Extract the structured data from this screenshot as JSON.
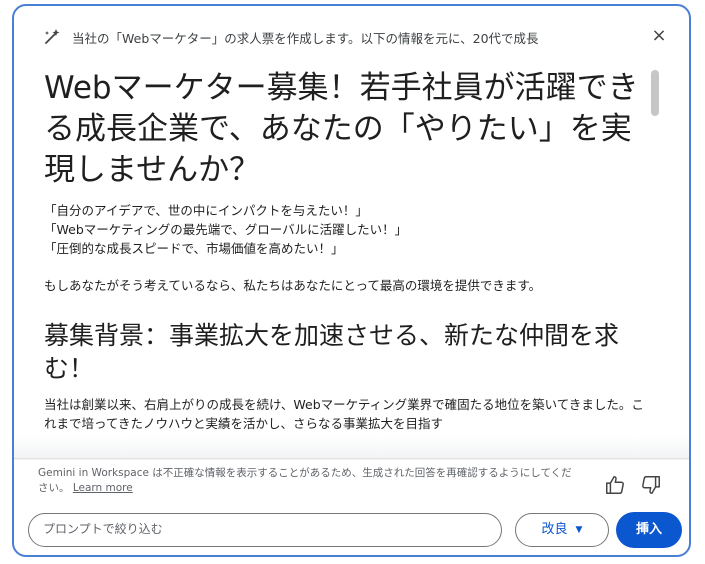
{
  "header": {
    "prompt_text": "当社の「Webマーケター」の求人票を作成します。以下の情報を元に、20代で成長",
    "close_label": "×"
  },
  "content": {
    "title": "Webマーケター募集！若手社員が活躍できる成長企業で、あなたの「やりたい」を実現しませんか？",
    "quotes": [
      "「自分のアイデアで、世の中にインパクトを与えたい！」",
      "「Webマーケティングの最先端で、グローバルに活躍したい！」",
      "「圧倒的な成長スピードで、市場価値を高めたい！」"
    ],
    "paragraph": "もしあなたがそう考えているなら、私たちはあなたにとって最高の環境を提供できます。",
    "section_heading": "募集背景：事業拡大を加速させる、新たな仲間を求む！",
    "section_text": "当社は創業以来、右肩上がりの成長を続け、Webマーケティング業界で確固たる地位を築いてきました。これまで培ってきたノウハウと実績を活かし、さらなる事業拡大を目指す"
  },
  "footer": {
    "disclaimer": "Gemini in Workspace は不正確な情報を表示することがあるため、生成された回答を再確認するようにしてください。",
    "learn_more": "Learn more",
    "input_placeholder": "プロンプトで絞り込む",
    "refine_label": "改良",
    "insert_label": "挿入"
  },
  "colors": {
    "accent": "#0b57d0",
    "border": "#4a7fd6"
  }
}
